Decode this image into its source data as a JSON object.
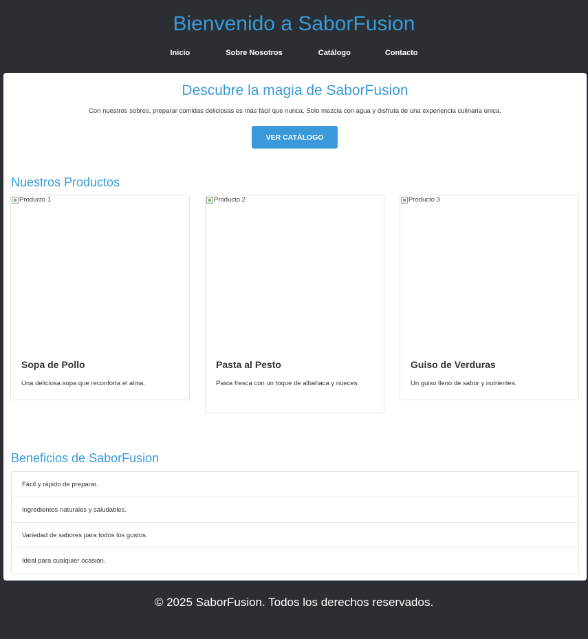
{
  "header": {
    "title": "Bienvenido a SaborFusion",
    "nav": [
      "Inicio",
      "Sobre Nosotros",
      "Catálogo",
      "Contacto"
    ]
  },
  "hero": {
    "title": "Descubre la magia de SaborFusion",
    "text": "Con nuestros sobres, preparar comidas deliciosas es más fácil que nunca. Solo mezcla con agua y disfruta de una experiencia culinaria única.",
    "button": "VER CATÁLOGO"
  },
  "products": {
    "title": "Nuestros Productos",
    "items": [
      {
        "alt": "Producto 1",
        "name": "Sopa de Pollo",
        "desc": "Una deliciosa sopa que reconforta el alma."
      },
      {
        "alt": "Producto 2",
        "name": "Pasta al Pesto",
        "desc": "Pasta fresca con un toque de albahaca y nueces."
      },
      {
        "alt": "Producto 3",
        "name": "Guiso de Verduras",
        "desc": "Un guiso lleno de sabor y nutrientes."
      }
    ]
  },
  "benefits": {
    "title": "Beneficios de SaborFusion",
    "items": [
      "Fácil y rápido de preparar.",
      "Ingredientes naturales y saludables.",
      "Variedad de sabores para todos los gustos.",
      "Ideal para cualquier ocasión."
    ]
  },
  "footer": {
    "text": "© 2025 SaborFusion. Todos los derechos reservados."
  },
  "colors": {
    "accent": "#3a9ad9",
    "dark": "#2b2f33"
  }
}
